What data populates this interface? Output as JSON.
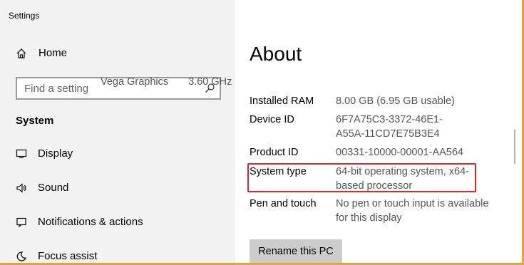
{
  "window": {
    "title": "Settings",
    "frame_color": "#f0a030"
  },
  "nav": {
    "home_label": "Home",
    "search_placeholder": "Find a setting",
    "section_title": "System",
    "items": [
      {
        "label": "Display",
        "icon": "monitor-icon"
      },
      {
        "label": "Sound",
        "icon": "speaker-icon"
      },
      {
        "label": "Notifications & actions",
        "icon": "notification-icon"
      },
      {
        "label": "Focus assist",
        "icon": "moon-icon"
      }
    ]
  },
  "about": {
    "title": "About",
    "partial_line": {
      "left": "Vega Graphics",
      "right": "3.60 GHz"
    },
    "rows": [
      {
        "label": "Installed RAM",
        "value": [
          "8.00 GB (6.95 GB usable)"
        ]
      },
      {
        "label": "Device ID",
        "value": [
          "6F7A75C3-3372-46E1-",
          "A55A-11CD7E75B3E4"
        ]
      },
      {
        "label": "Product ID",
        "value": [
          "00331-10000-00001-AA564"
        ]
      },
      {
        "label": "System type",
        "value": [
          "64-bit operating system, x64-",
          "based processor"
        ]
      },
      {
        "label": "Pen and touch",
        "value": [
          "No pen or touch input is available",
          "for this display"
        ]
      }
    ],
    "rename_button": "Rename this PC",
    "highlight_color": "#e0262b"
  }
}
